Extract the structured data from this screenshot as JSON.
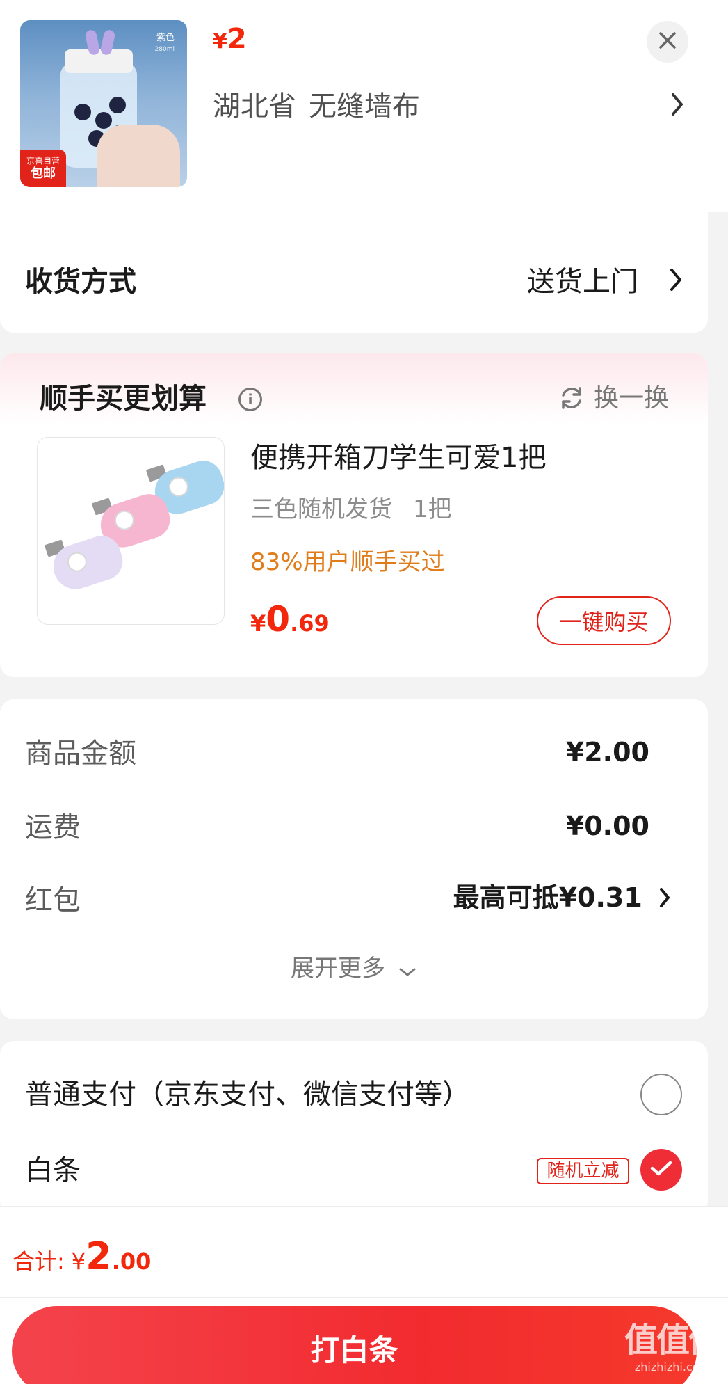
{
  "header": {
    "price_currency": "¥",
    "price_value": "2",
    "province": "湖北省",
    "spec": "无缝墙布",
    "thumb_color": "紫色",
    "thumb_volume": "280ml",
    "thumb_badge_line1": "京喜自营",
    "thumb_badge_line2": "包邮"
  },
  "delivery": {
    "label": "收货方式",
    "value": "送货上门"
  },
  "addon": {
    "title": "顺手买更划算",
    "info_glyph": "i",
    "swap_label": "换一换",
    "item_name": "便携开箱刀学生可爱1把",
    "item_spec": "三色随机发货",
    "item_qty": "1把",
    "bought_text": "83%用户顺手买过",
    "price_currency": "¥",
    "price_int": "0",
    "price_dec": ".69",
    "buy_button": "一键购买"
  },
  "summary": {
    "goods_label": "商品金额",
    "goods_value": "¥2.00",
    "shipping_label": "运费",
    "shipping_value": "¥0.00",
    "redpacket_label": "红包",
    "redpacket_value": "最高可抵¥0.31",
    "expand_label": "展开更多"
  },
  "payment": {
    "normal_label": "普通支付（京东支付、微信支付等）",
    "normal_selected": false,
    "baitiao_label": "白条",
    "baitiao_tag": "随机立减",
    "baitiao_selected": true
  },
  "footer": {
    "total_label": "合计:",
    "total_currency": "¥",
    "total_int": "2",
    "total_dec": ".00",
    "pay_button": "打白条",
    "watermark_big": "值值值",
    "watermark_small": "zhizhizhi.com"
  },
  "colors": {
    "accent_red": "#f2270c",
    "button_red": "#f22b2f",
    "orange": "#e07c1a"
  }
}
